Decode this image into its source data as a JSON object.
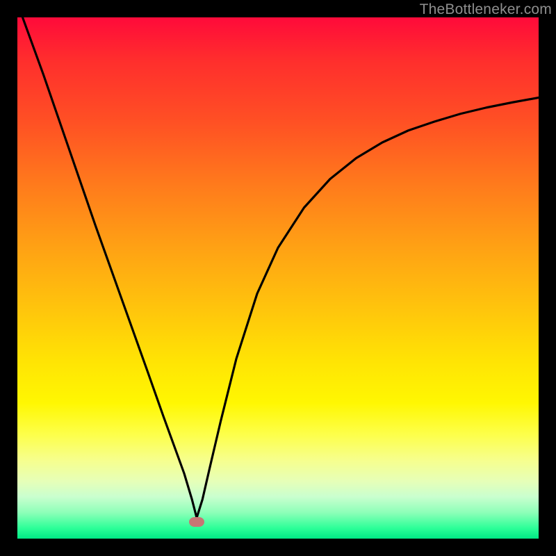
{
  "watermark": "TheBottleneker.com",
  "marker": {
    "cx_frac": 0.344,
    "cy_frac": 0.968
  },
  "chart_data": {
    "type": "line",
    "title": "",
    "xlabel": "",
    "ylabel": "",
    "xlim": [
      0,
      1
    ],
    "ylim": [
      0,
      1
    ],
    "series": [
      {
        "name": "bottleneck-curve",
        "x": [
          0.01,
          0.05,
          0.1,
          0.15,
          0.2,
          0.25,
          0.28,
          0.3,
          0.32,
          0.335,
          0.344,
          0.355,
          0.37,
          0.39,
          0.42,
          0.46,
          0.5,
          0.55,
          0.6,
          0.65,
          0.7,
          0.75,
          0.8,
          0.85,
          0.9,
          0.95,
          1.0
        ],
        "y": [
          1.0,
          0.89,
          0.745,
          0.6,
          0.46,
          0.32,
          0.235,
          0.18,
          0.125,
          0.075,
          0.04,
          0.075,
          0.14,
          0.225,
          0.345,
          0.47,
          0.558,
          0.635,
          0.69,
          0.73,
          0.76,
          0.783,
          0.8,
          0.815,
          0.827,
          0.837,
          0.846
        ]
      }
    ],
    "optimum_marker": {
      "x": 0.344,
      "y": 0.032
    },
    "gradient_direction": "top_red_bottom_green"
  }
}
